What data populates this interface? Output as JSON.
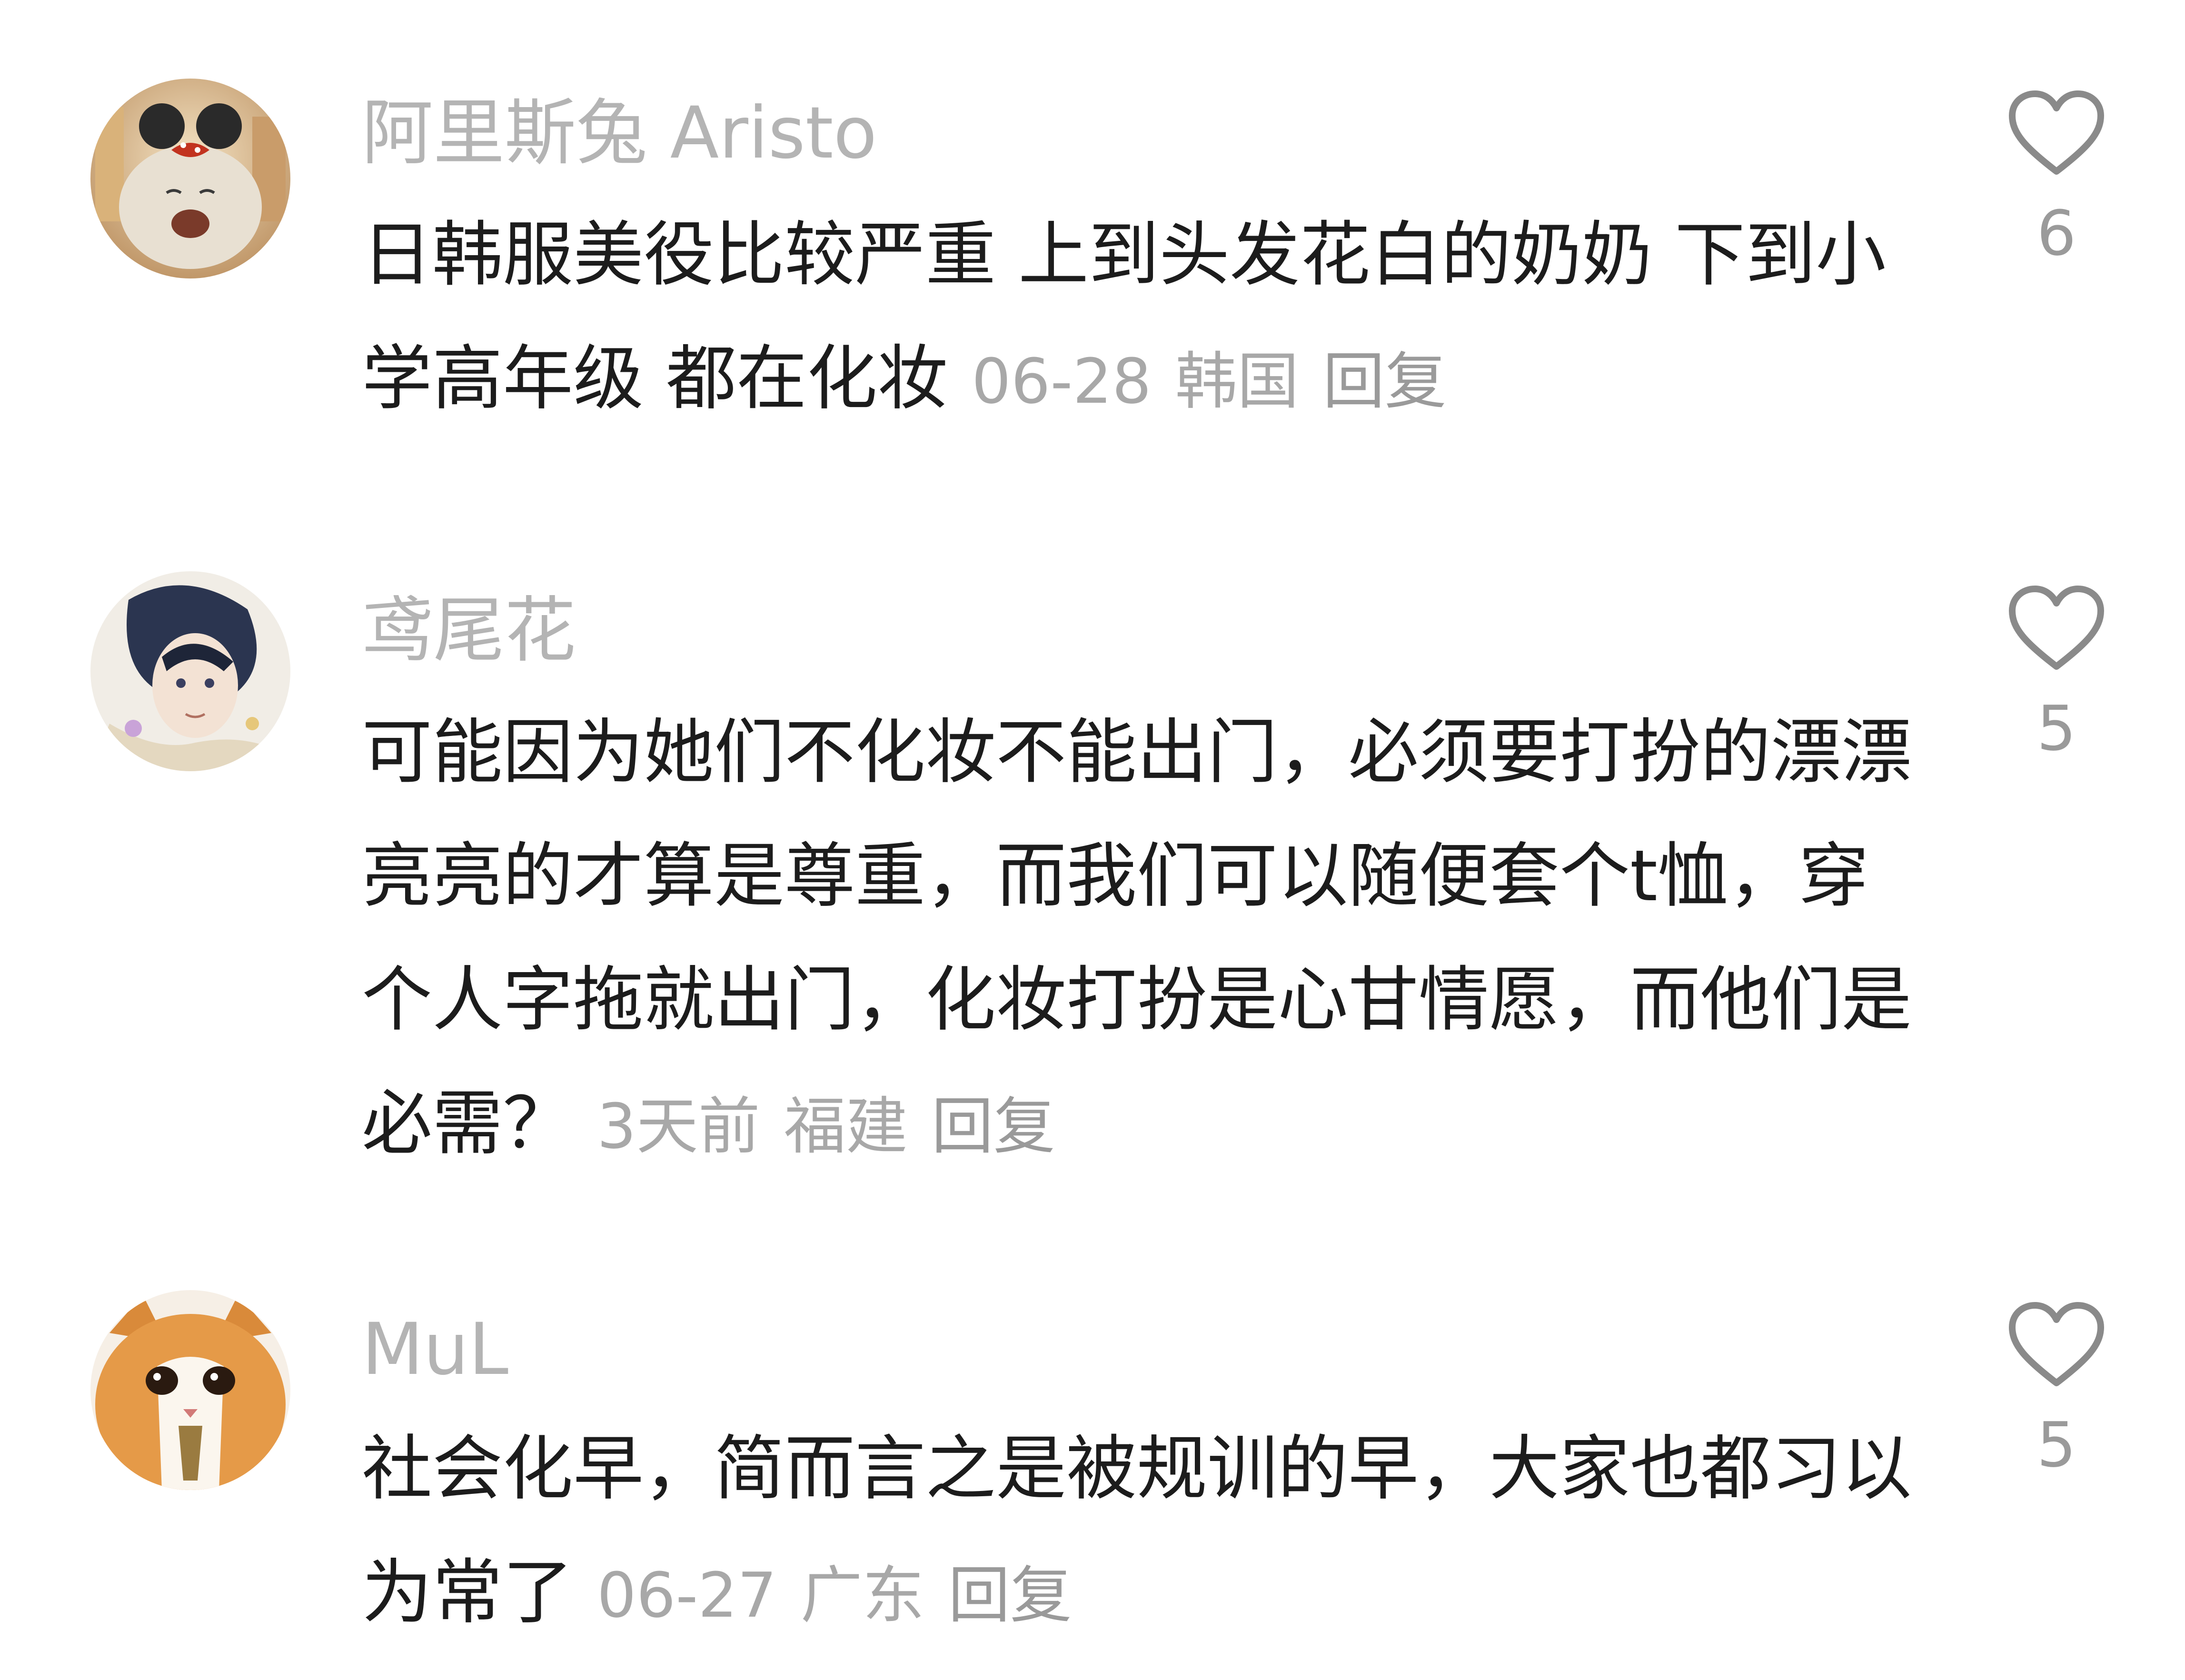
{
  "comments": [
    {
      "username": "阿里斯兔 Aristo",
      "text": "日韩服美役比较严重 上到头发花白的奶奶 下到小学高年级 都在化妆",
      "date": "06-28",
      "location": "韩国",
      "reply_label": "回复",
      "likes": "6",
      "avatar_icon": "cat-with-mouse-ears-icon"
    },
    {
      "username": "鸢尾花",
      "text": "可能因为她们不化妆不能出门，必须要打扮的漂漂亮亮的才算是尊重，而我们可以随便套个t恤，穿个人字拖就出门，化妆打扮是心甘情愿，而他们是必需？",
      "date": "3天前",
      "location": "福建",
      "reply_label": "回复",
      "likes": "5",
      "avatar_icon": "anime-character-icon"
    },
    {
      "username": "MuL",
      "text": "社会化早，简而言之是被规训的早，大家也都习以为常了",
      "date": "06-27",
      "location": "广东",
      "reply_label": "回复",
      "likes": "5",
      "avatar_icon": "orange-cat-icon"
    }
  ],
  "colors": {
    "username": "#b4b4b4",
    "text": "#1c1c1c",
    "meta": "#a8a8a8",
    "icon": "#8a8a8a"
  }
}
